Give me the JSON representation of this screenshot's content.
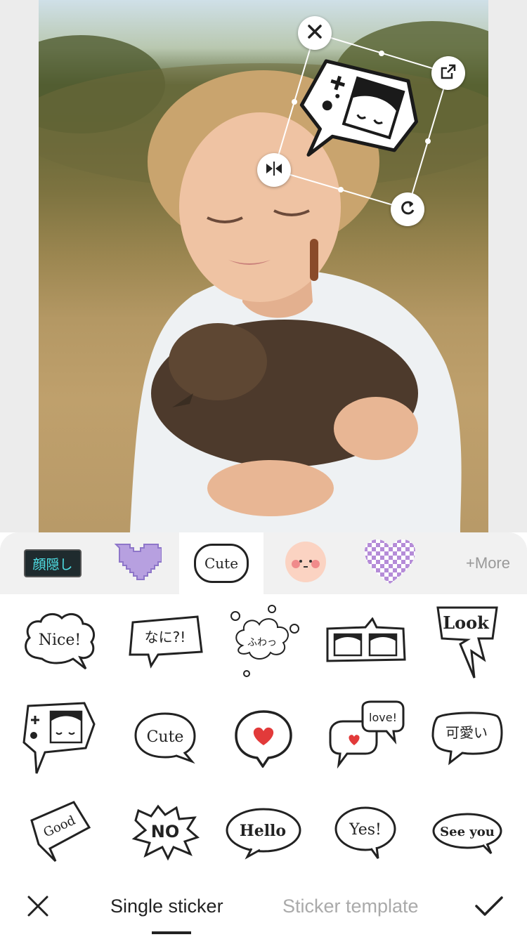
{
  "editor": {
    "sticker_handles": {
      "close": "close-icon",
      "resize": "external-resize-icon",
      "flip": "flip-horizontal-icon",
      "rotate": "rotate-icon"
    }
  },
  "categories": [
    {
      "label": "顔隠し",
      "icon": "face-hide-sticker-pack"
    },
    {
      "label": "",
      "icon": "pixel-heart-pack"
    },
    {
      "label": "Cute",
      "icon": "cute-bubble-pack",
      "active": true
    },
    {
      "label": "",
      "icon": "blush-face-pack"
    },
    {
      "label": "",
      "icon": "checker-heart-pack"
    }
  ],
  "more_label": "+More",
  "stickers": [
    {
      "text": "Nice!"
    },
    {
      "text": "なに?!"
    },
    {
      "text": "ふわっ"
    },
    {
      "text": ""
    },
    {
      "text": "Look"
    },
    {
      "text": ""
    },
    {
      "text": "Cute"
    },
    {
      "text": ""
    },
    {
      "text": "love!"
    },
    {
      "text": "可愛い"
    },
    {
      "text": "Good"
    },
    {
      "text": "NO"
    },
    {
      "text": "Hello"
    },
    {
      "text": "Yes!"
    },
    {
      "text": "See you"
    }
  ],
  "bottom_bar": {
    "tab_single": "Single sticker",
    "tab_template": "Sticker template"
  },
  "colors": {
    "accent_dark": "#222222",
    "heart_red": "#e23a3a",
    "purple": "#b58cd8"
  }
}
